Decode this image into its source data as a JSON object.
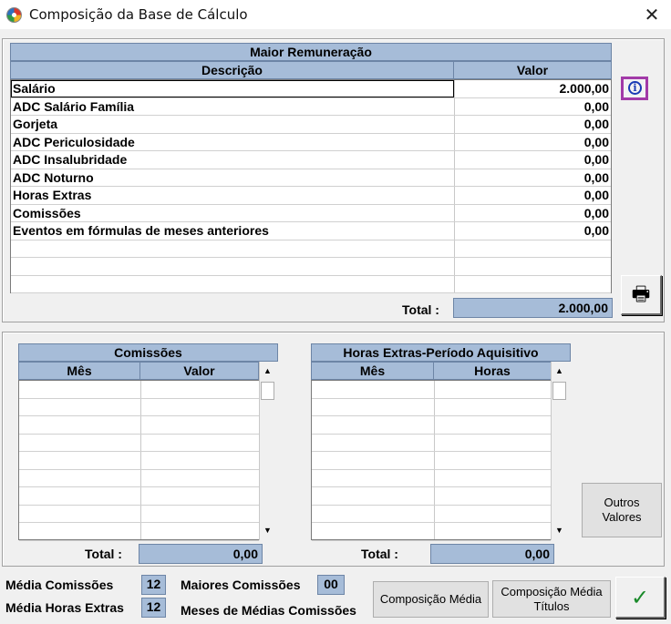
{
  "window": {
    "title": "Composição da Base de Cálculo",
    "close_glyph": "✕"
  },
  "maior": {
    "title": "Maior Remuneração",
    "col_desc": "Descrição",
    "col_val": "Valor",
    "rows": [
      {
        "desc": "Salário",
        "val": "2.000,00"
      },
      {
        "desc": "ADC Salário Família",
        "val": "0,00"
      },
      {
        "desc": "Gorjeta",
        "val": "0,00"
      },
      {
        "desc": "ADC Periculosidade",
        "val": "0,00"
      },
      {
        "desc": "ADC Insalubridade",
        "val": "0,00"
      },
      {
        "desc": "ADC Noturno",
        "val": "0,00"
      },
      {
        "desc": "Horas Extras",
        "val": "0,00"
      },
      {
        "desc": "Comissões",
        "val": "0,00"
      },
      {
        "desc": "Eventos em fórmulas de meses anteriores",
        "val": "0,00"
      }
    ],
    "total_label": "Total :",
    "total_value": "2.000,00",
    "info_icon": "i",
    "print_icon": "🖶"
  },
  "comissoes": {
    "title": "Comissões",
    "col1": "Mês",
    "col2": "Valor",
    "total_label": "Total :",
    "total_value": "0,00"
  },
  "horas": {
    "title": "Horas Extras-Período Aquisitivo",
    "col1": "Mês",
    "col2": "Horas",
    "total_label": "Total :",
    "total_value": "0,00"
  },
  "buttons": {
    "outros_valores": "Outros Valores",
    "composicao_media": "Composição Média",
    "composicao_media_titulos": "Composição Média Títulos",
    "ok_glyph": "✓"
  },
  "footer": {
    "media_comissoes_label": "Média Comissões",
    "media_comissoes_value": "12",
    "media_horas_label": "Média Horas Extras",
    "media_horas_value": "12",
    "maiores_comissoes_label": "Maiores Comissões",
    "maiores_comissoes_value": "00",
    "meses_medias_label": "Meses de Médias Comissões"
  },
  "scroll": {
    "up": "▲",
    "down": "▼"
  }
}
